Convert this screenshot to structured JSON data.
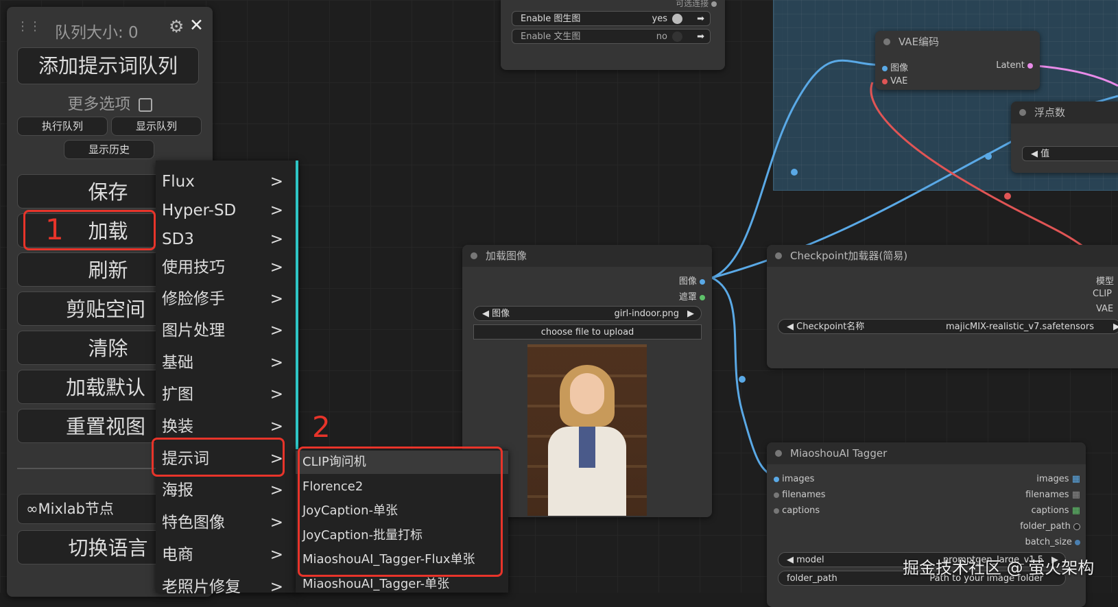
{
  "panel": {
    "queue_size": "队列大小: 0",
    "add_prompt_queue": "添加提示词队列",
    "more_options": "更多选项",
    "execute_queue": "执行队列",
    "show_queue": "显示队列",
    "show_history": "显示历史",
    "buttons": [
      "保存",
      "加载",
      "刷新",
      "剪贴空间",
      "清除",
      "加载默认",
      "重置视图"
    ],
    "mixlab_nodes": "∞Mixlab节点",
    "switch_language": "切换语言"
  },
  "menu_main": [
    {
      "label": "Flux"
    },
    {
      "label": "Hyper-SD"
    },
    {
      "label": "SD3"
    },
    {
      "label": "使用技巧"
    },
    {
      "label": "修脸修手"
    },
    {
      "label": "图片处理"
    },
    {
      "label": "基础"
    },
    {
      "label": "扩图"
    },
    {
      "label": "换装"
    },
    {
      "label": "提示词"
    },
    {
      "label": "海报"
    },
    {
      "label": "特色图像"
    },
    {
      "label": "电商"
    },
    {
      "label": "老照片修复"
    }
  ],
  "menu_arrow": ">",
  "menu_sub": [
    "CLIP询问机",
    "Florence2",
    "JoyCaption-单张",
    "JoyCaption-批量打标",
    "MiaoshouAI_Tagger-Flux单张",
    "MiaoshouAI_Tagger-单张"
  ],
  "annotations": {
    "one": "1",
    "two": "2"
  },
  "node_top": {
    "optional_connect": "可选连接",
    "enable_img2img": "Enable 图生图",
    "enable_img2img_value": "yes",
    "enable_txt2img": "Enable 文生图",
    "enable_txt2img_value": "no"
  },
  "node_vae": {
    "title": "VAE编码",
    "in_image": "图像",
    "in_vae": "VAE",
    "out_latent": "Latent"
  },
  "node_float": {
    "title": "浮点数",
    "value_label": "值"
  },
  "node_load_image": {
    "title": "加载图像",
    "out_image": "图像",
    "out_mask": "遮罩",
    "image_label": "图像",
    "image_value": "girl-indoor.png",
    "upload_button": "choose file to upload"
  },
  "node_checkpoint": {
    "title": "Checkpoint加载器(简易)",
    "out_model": "模型",
    "out_clip": "CLIP",
    "out_vae": "VAE",
    "ckpt_label": "Checkpoint名称",
    "ckpt_value": "majicMIX-realistic_v7.safetensors"
  },
  "node_tagger": {
    "title": "MiaoshouAI Tagger",
    "in_images": "images",
    "in_filenames": "filenames",
    "in_captions": "captions",
    "out_images": "images",
    "out_filenames": "filenames",
    "out_captions": "captions",
    "out_folder_path": "folder_path",
    "out_batch_size": "batch_size",
    "model_label": "model",
    "model_value": "promptgen_large_v1.5",
    "folder_label": "folder_path",
    "folder_value": "Path to your image folder"
  },
  "watermark": "掘金技术社区 @ 萤火架构",
  "colors": {
    "accent_red": "#e8342a",
    "link_blue": "#5aa9e6",
    "link_red": "#e05555",
    "link_pink": "#e88be8",
    "menu_edge": "#2ec5c5"
  }
}
